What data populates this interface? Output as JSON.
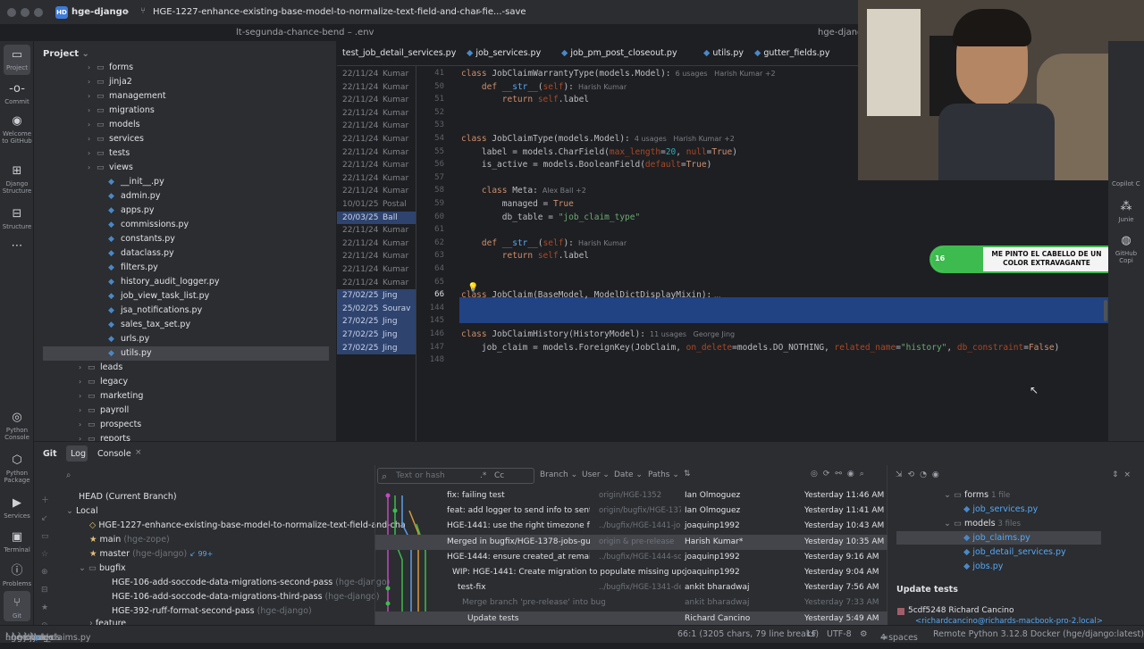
{
  "titlebar": {
    "project_badge": "HD",
    "project_name": "hge-django",
    "branch": "HGE-1227-enhance-existing-base-model-to-normalize-text-field-and-char-fie...-save",
    "subtab_left": "lt-segunda-chance-bend – .env",
    "subtab_right": "hge-django"
  },
  "leftbar": [
    {
      "label": "Project",
      "icon": "folder-icon"
    },
    {
      "label": "Commit",
      "icon": "commit-icon"
    },
    {
      "label": "Welcome to GitHub",
      "icon": "github-icon"
    },
    {
      "label": "Django Structure",
      "icon": "django-icon"
    },
    {
      "label": "Structure",
      "icon": "structure-icon"
    },
    {
      "label": "Python Console",
      "icon": "python-console-icon"
    },
    {
      "label": "Python Package",
      "icon": "python-package-icon"
    },
    {
      "label": "Services",
      "icon": "services-icon"
    },
    {
      "label": "Terminal",
      "icon": "terminal-icon"
    },
    {
      "label": "Problems",
      "icon": "problems-icon"
    },
    {
      "label": "Git",
      "icon": "git-icon"
    }
  ],
  "project_panel": {
    "title": "Project",
    "tree": [
      {
        "name": "forms",
        "type": "folder",
        "depth": 1
      },
      {
        "name": "jinja2",
        "type": "folder",
        "depth": 1
      },
      {
        "name": "management",
        "type": "folder",
        "depth": 1
      },
      {
        "name": "migrations",
        "type": "folder",
        "depth": 1
      },
      {
        "name": "models",
        "type": "folder",
        "depth": 1
      },
      {
        "name": "services",
        "type": "folder",
        "depth": 1
      },
      {
        "name": "tests",
        "type": "folder",
        "depth": 1
      },
      {
        "name": "views",
        "type": "folder",
        "depth": 1
      },
      {
        "name": "__init__.py",
        "type": "py",
        "depth": 2
      },
      {
        "name": "admin.py",
        "type": "py",
        "depth": 2
      },
      {
        "name": "apps.py",
        "type": "py",
        "depth": 2
      },
      {
        "name": "commissions.py",
        "type": "py",
        "depth": 2
      },
      {
        "name": "constants.py",
        "type": "py",
        "depth": 2
      },
      {
        "name": "dataclass.py",
        "type": "py",
        "depth": 2
      },
      {
        "name": "filters.py",
        "type": "py",
        "depth": 2
      },
      {
        "name": "history_audit_logger.py",
        "type": "py",
        "depth": 2
      },
      {
        "name": "job_view_task_list.py",
        "type": "py",
        "depth": 2
      },
      {
        "name": "jsa_notifications.py",
        "type": "py",
        "depth": 2
      },
      {
        "name": "sales_tax_set.py",
        "type": "py",
        "depth": 2
      },
      {
        "name": "urls.py",
        "type": "py",
        "depth": 2
      },
      {
        "name": "utils.py",
        "type": "py",
        "depth": 2,
        "selected": true
      },
      {
        "name": "leads",
        "type": "folder",
        "depth": 0
      },
      {
        "name": "legacy",
        "type": "folder",
        "depth": 0
      },
      {
        "name": "marketing",
        "type": "folder",
        "depth": 0
      },
      {
        "name": "payroll",
        "type": "folder",
        "depth": 0
      },
      {
        "name": "prospects",
        "type": "folder",
        "depth": 0
      },
      {
        "name": "reports",
        "type": "folder",
        "depth": 0
      }
    ]
  },
  "editor_tabs": [
    "test_job_detail_services.py",
    "job_services.py",
    "job_pm_post_closeout.py",
    "utils.py",
    "gutter_fields.py"
  ],
  "editor_lines": [
    {
      "date": "22/11/24",
      "author": "Kumar",
      "ln": "41",
      "code": [
        [
          "kw",
          "class "
        ],
        [
          "cls",
          "JobClaimWarrantyType(models.Model):"
        ],
        [
          "cm",
          "  6 usages   Harish Kumar +2"
        ]
      ]
    },
    {
      "date": "22/11/24",
      "author": "Kumar",
      "ln": "50",
      "code": [
        [
          "sp",
          "    "
        ],
        [
          "kw",
          "def "
        ],
        [
          "fn",
          "__str__"
        ],
        [
          "cls",
          "("
        ],
        [
          "par",
          "self"
        ],
        [
          "cls",
          "):"
        ],
        [
          "cm",
          "  Harish Kumar"
        ]
      ]
    },
    {
      "date": "22/11/24",
      "author": "Kumar",
      "ln": "51",
      "code": [
        [
          "sp",
          "        "
        ],
        [
          "kw",
          "return "
        ],
        [
          "par",
          "self"
        ],
        [
          "cls",
          ".label"
        ]
      ]
    },
    {
      "date": "22/11/24",
      "author": "Kumar",
      "ln": "52",
      "code": []
    },
    {
      "date": "22/11/24",
      "author": "Kumar",
      "ln": "53",
      "code": []
    },
    {
      "date": "22/11/24",
      "author": "Kumar",
      "ln": "54",
      "code": [
        [
          "kw",
          "class "
        ],
        [
          "cls",
          "JobClaimType(models.Model):"
        ],
        [
          "cm",
          "  4 usages   Harish Kumar +2"
        ]
      ]
    },
    {
      "date": "22/11/24",
      "author": "Kumar",
      "ln": "55",
      "code": [
        [
          "sp",
          "    "
        ],
        [
          "cls",
          "label = models.CharField("
        ],
        [
          "par",
          "max_length"
        ],
        [
          "cls",
          "="
        ],
        [
          "num",
          "20"
        ],
        [
          "cls",
          ", "
        ],
        [
          "par",
          "null"
        ],
        [
          "cls",
          "="
        ],
        [
          "kw",
          "True"
        ],
        [
          "cls",
          ")"
        ]
      ]
    },
    {
      "date": "22/11/24",
      "author": "Kumar",
      "ln": "56",
      "code": [
        [
          "sp",
          "    "
        ],
        [
          "cls",
          "is_active = models.BooleanField("
        ],
        [
          "par",
          "default"
        ],
        [
          "cls",
          "="
        ],
        [
          "kw",
          "True"
        ],
        [
          "cls",
          ")"
        ]
      ]
    },
    {
      "date": "22/11/24",
      "author": "Kumar",
      "ln": "57",
      "code": []
    },
    {
      "date": "22/11/24",
      "author": "Kumar",
      "ln": "58",
      "code": [
        [
          "sp",
          "    "
        ],
        [
          "kw",
          "class "
        ],
        [
          "cls",
          "Meta:"
        ],
        [
          "cm",
          "  Alex Ball +2"
        ]
      ]
    },
    {
      "date": "10/01/25",
      "author": "Postal",
      "ln": "59",
      "code": [
        [
          "sp",
          "        "
        ],
        [
          "cls",
          "managed = "
        ],
        [
          "kw",
          "True"
        ]
      ]
    },
    {
      "date": "20/03/25",
      "author": "Ball",
      "ln": "60",
      "code": [
        [
          "sp",
          "        "
        ],
        [
          "cls",
          "db_table = "
        ],
        [
          "str",
          "\"job_claim_type\""
        ]
      ],
      "hl": true
    },
    {
      "date": "22/11/24",
      "author": "Kumar",
      "ln": "61",
      "code": []
    },
    {
      "date": "22/11/24",
      "author": "Kumar",
      "ln": "62",
      "code": [
        [
          "sp",
          "    "
        ],
        [
          "kw",
          "def "
        ],
        [
          "fn",
          "__str__"
        ],
        [
          "cls",
          "("
        ],
        [
          "par",
          "self"
        ],
        [
          "cls",
          "):"
        ],
        [
          "cm",
          "  Harish Kumar"
        ]
      ]
    },
    {
      "date": "22/11/24",
      "author": "Kumar",
      "ln": "63",
      "code": [
        [
          "sp",
          "        "
        ],
        [
          "kw",
          "return "
        ],
        [
          "par",
          "self"
        ],
        [
          "cls",
          ".label"
        ]
      ]
    },
    {
      "date": "22/11/24",
      "author": "Kumar",
      "ln": "64",
      "code": []
    },
    {
      "date": "22/11/24",
      "author": "Kumar",
      "ln": "65",
      "code": []
    },
    {
      "date": "27/02/25",
      "author": "Jing",
      "ln": "66",
      "code": [
        [
          "kw",
          "class "
        ],
        [
          "cls",
          "JobClaim(BaseModel, ModelDictDisplayMixin):"
        ],
        [
          "cm",
          " ..."
        ]
      ],
      "hl": true
    },
    {
      "date": "25/02/25",
      "author": "Sourav",
      "ln": "144",
      "code": [],
      "hl": true
    },
    {
      "date": "27/02/25",
      "author": "Jing",
      "ln": "145",
      "code": [],
      "hl": true
    },
    {
      "date": "27/02/25",
      "author": "Jing",
      "ln": "146",
      "code": [
        [
          "kw",
          "class "
        ],
        [
          "cls",
          "JobClaimHistory(HistoryModel):"
        ],
        [
          "cm",
          "  11 usages   George Jing"
        ]
      ],
      "hl": true
    },
    {
      "date": "27/02/25",
      "author": "Jing",
      "ln": "147",
      "code": [
        [
          "sp",
          "    "
        ],
        [
          "cls",
          "job_claim = models.ForeignKey(JobClaim, "
        ],
        [
          "par",
          "on_delete"
        ],
        [
          "cls",
          "=models.DO_NOTHING, "
        ],
        [
          "par",
          "related_name"
        ],
        [
          "cls",
          "="
        ],
        [
          "str",
          "\"history\""
        ],
        [
          "cls",
          ", "
        ],
        [
          "par",
          "db_constraint"
        ],
        [
          "cls",
          "="
        ],
        [
          "kw",
          "False"
        ],
        [
          "cls",
          ")"
        ]
      ],
      "hl": true
    },
    {
      "date": "",
      "author": "",
      "ln": "148",
      "code": []
    }
  ],
  "rightbar": {
    "copilot_label": "Copilot C",
    "junie_label": "Junie",
    "github_copilot_label": "GitHub Copi"
  },
  "banner": {
    "text": "ME PINTO EL CABELLO DE UN COLOR EXTRAVAGANTE",
    "left_count": "16",
    "right_count": "50"
  },
  "bottom": {
    "tabs": [
      "Git",
      "Log",
      "Console"
    ],
    "search_placeholder": "Text or hash",
    "filters": [
      "Branch",
      "User",
      "Date",
      "Paths"
    ],
    "regex_label": ".*",
    "case_label": "Cc",
    "branches": {
      "head": "HEAD (Current Branch)",
      "local_label": "Local",
      "local_branches": [
        {
          "name": "HGE-1227-enhance-existing-base-model-to-normalize-text-field-and-cha",
          "tag": ""
        },
        {
          "name": "main",
          "tag": "(hge-zope)"
        },
        {
          "name": "master",
          "tag": "(hge-django)",
          "extra": "↙ 99+"
        }
      ],
      "bugfix_label": "bugfix",
      "bugfix_branches": [
        {
          "name": "HGE-106-add-soccode-data-migrations-second-pass",
          "tag": "(hge-django)"
        },
        {
          "name": "HGE-106-add-soccode-data-migrations-third-pass",
          "tag": "(hge-django)"
        },
        {
          "name": "HGE-392-ruff-format-second-pass",
          "tag": "(hge-django)"
        }
      ],
      "feature_label": "feature"
    },
    "commits": [
      {
        "msg": "fix: failing test",
        "ref": "origin/HGE-1352",
        "author": "Ian Olmoguez",
        "date": "Yesterday 11:46 AM"
      },
      {
        "msg": "feat: add logger to send info to sentry",
        "ref": "origin/bugfix/HGE-1372",
        "author": "Ian Olmoguez",
        "date": "Yesterday 11:41 AM"
      },
      {
        "msg": "HGE-1441: use the right timezone func",
        "ref": "../bugfix/HGE-1441-jo",
        "author": "joaquinp1992",
        "date": "Yesterday 10:43 AM"
      },
      {
        "msg": "Merged in bugfix/HGE-1378-jobs-gutters",
        "ref": "origin & pre-release",
        "author": "Harish Kumar*",
        "date": "Yesterday 10:35 AM",
        "sel": true
      },
      {
        "msg": "HGE-1444: ensure created_at remains",
        "ref": "../bugfix/HGE-1444-so",
        "author": "joaquinp1992",
        "date": "Yesterday 9:16 AM"
      },
      {
        "msg": "WIP: HGE-1441: Create migration to populate missing updated_",
        "ref": "",
        "author": "joaquinp1992",
        "date": "Yesterday 9:04 AM"
      },
      {
        "msg": "test-fix",
        "ref": "../bugfix/HGE-1341-de",
        "author": "ankit bharadwaj",
        "date": "Yesterday 7:56 AM"
      },
      {
        "msg": "Merge branch 'pre-release' into bugfix/HGE-1341-devops-re",
        "ref": "",
        "author": "ankit bharadwaj",
        "date": "Yesterday 7:33 AM",
        "dim": true
      },
      {
        "msg": "Update tests",
        "ref": "",
        "author": "Richard Cancino",
        "date": "Yesterday 5:49 AM",
        "sel2": true
      }
    ],
    "changes": {
      "forms_label": "forms",
      "forms_count": "1 file",
      "forms_files": [
        "job_services.py"
      ],
      "models_label": "models",
      "models_count": "3 files",
      "models_files": [
        "job_claims.py",
        "job_detail_services.py",
        "jobs.py"
      ],
      "commit_title": "Update tests",
      "commit_hash_author": "5cdf5248 Richard Cancino",
      "commit_email": "<richardcancino@richards-macbook-pro-2.local>"
    }
  },
  "statusbar": {
    "breadcrumb": [
      "hge-django",
      "hge",
      "modules",
      "jobs",
      "models",
      "job_claims.py"
    ],
    "position": "66:1 (3205 chars, 79 line breaks)",
    "line_ending": "LF",
    "encoding": "UTF-8",
    "indent": "4 spaces",
    "interpreter": "Remote Python 3.12.8 Docker (hge/django:latest)"
  },
  "colors": {
    "accent": "#214283",
    "selection": "#2e436e",
    "banner_green": "#3dbb4f"
  }
}
